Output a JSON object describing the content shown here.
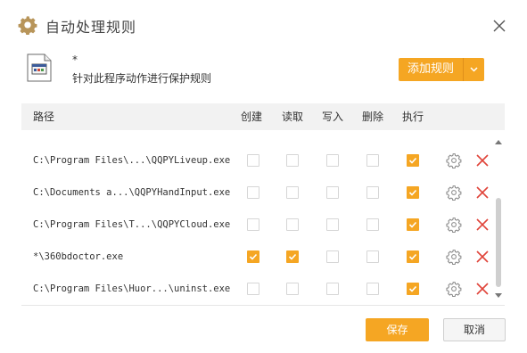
{
  "window": {
    "title": "自动处理规则",
    "close_icon": "close-icon",
    "title_icon": "gear-icon"
  },
  "program": {
    "name": "*",
    "description": "针对此程序动作进行保护规则",
    "icon": "executable-file-icon"
  },
  "add_rule_button": {
    "label": "添加规则",
    "icon": "chevron-down-icon"
  },
  "table": {
    "columns": {
      "path": "路径",
      "create": "创建",
      "read": "读取",
      "write": "写入",
      "delete": "删除",
      "execute": "执行"
    },
    "rows": [
      {
        "path": "C:\\Program Files\\...\\QQPYLiveup.exe",
        "create": false,
        "read": false,
        "write": false,
        "delete": false,
        "execute": true
      },
      {
        "path": "C:\\Documents a...\\QQPYHandInput.exe",
        "create": false,
        "read": false,
        "write": false,
        "delete": false,
        "execute": true
      },
      {
        "path": "C:\\Program Files\\T...\\QQPYCloud.exe",
        "create": false,
        "read": false,
        "write": false,
        "delete": false,
        "execute": true
      },
      {
        "path": "*\\360bdoctor.exe",
        "create": true,
        "read": true,
        "write": false,
        "delete": false,
        "execute": true
      },
      {
        "path": "C:\\Program Files\\Huor...\\uninst.exe",
        "create": false,
        "read": false,
        "write": false,
        "delete": false,
        "execute": true
      }
    ]
  },
  "footer": {
    "save_label": "保存",
    "cancel_label": "取消"
  },
  "colors": {
    "accent": "#f5a623",
    "delete_red": "#e0443a",
    "gear_gray": "#8a8a8a",
    "title_icon": "#b8955a"
  }
}
